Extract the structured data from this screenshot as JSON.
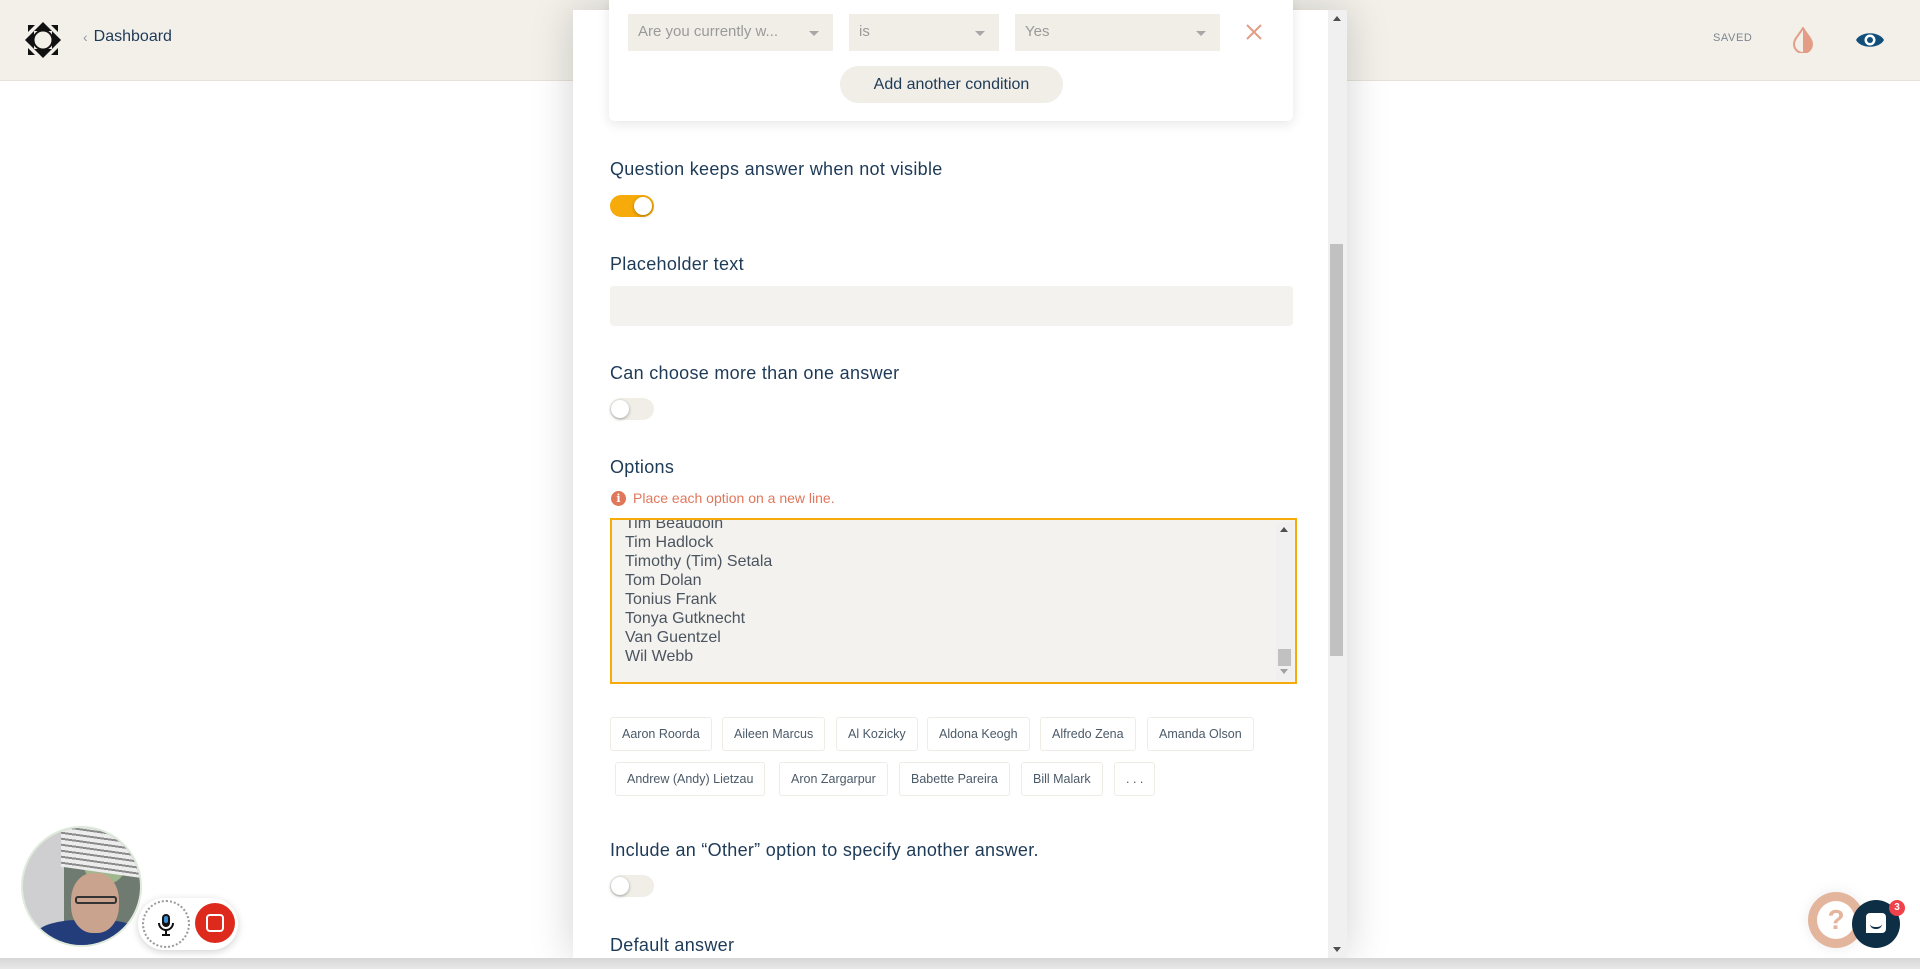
{
  "header": {
    "back_label": "Dashboard",
    "status": "SAVED",
    "icons": [
      "logo-icon",
      "chevron-left-icon",
      "theme-drop-icon",
      "preview-eye-icon"
    ],
    "colors": {
      "drop": "#e39d86",
      "eye": "#0f4f7a"
    }
  },
  "conditions": {
    "field_select": "Are you currently w...",
    "operator_select": "is",
    "value_select": "Yes",
    "add_label": "Add another condition"
  },
  "settings": {
    "keep_answer_label": "Question keeps answer when not visible",
    "keep_answer_on": true,
    "placeholder_label": "Placeholder text",
    "placeholder_value": "",
    "multi_label": "Can choose more than one answer",
    "multi_on": false,
    "options_label": "Options",
    "options_hint": "Place each option on a new line.",
    "options_lines": [
      "Tim Beaudoin",
      "Tim Hadlock",
      "Timothy (Tim) Setala",
      "Tom Dolan",
      "Tonius Frank",
      "Tonya Gutknecht",
      "Van Guentzel",
      "Wil Webb"
    ],
    "option_chips": [
      "Aaron Roorda",
      "Aileen Marcus",
      "Al Kozicky",
      "Aldona Keogh",
      "Alfredo Zena",
      "Amanda Olson",
      "Andrew (Andy) Lietzau",
      "Aron Zargarpur",
      "Babette Pareira",
      "Bill Malark",
      ". . ."
    ],
    "other_label": "Include an “Other” option to specify another answer.",
    "other_on": false,
    "default_label": "Default answer"
  },
  "widgets": {
    "chat_badge": "3",
    "help_glyph": "?"
  },
  "accent_color": "#f7ab0a"
}
